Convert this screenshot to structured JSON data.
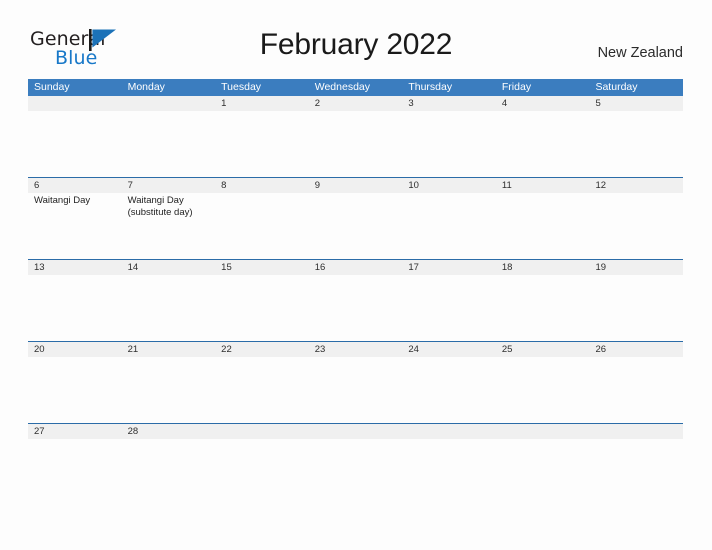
{
  "logo": {
    "word_one": "General",
    "word_two": "Blue",
    "flag_icon": "blue-triangle-flag-icon",
    "dark_color": "#231f20",
    "blue_color": "#1878c8"
  },
  "header": {
    "title": "February 2022",
    "country": "New Zealand"
  },
  "colors": {
    "header_blue": "#3b7dbf",
    "row_divider_blue": "#2b6ca8",
    "date_band_gray": "#f0f0f0",
    "page_background": "#fdfdfd",
    "text_dark": "#1f1f1f"
  },
  "calendar": {
    "month": "February",
    "year": "2022",
    "weekday_headers": [
      "Sunday",
      "Monday",
      "Tuesday",
      "Wednesday",
      "Thursday",
      "Friday",
      "Saturday"
    ],
    "weeks": [
      {
        "days": [
          {
            "date": "",
            "events": []
          },
          {
            "date": "",
            "events": []
          },
          {
            "date": "1",
            "events": []
          },
          {
            "date": "2",
            "events": []
          },
          {
            "date": "3",
            "events": []
          },
          {
            "date": "4",
            "events": []
          },
          {
            "date": "5",
            "events": []
          }
        ]
      },
      {
        "days": [
          {
            "date": "6",
            "events": [
              "Waitangi Day"
            ]
          },
          {
            "date": "7",
            "events": [
              "Waitangi Day",
              "(substitute day)"
            ]
          },
          {
            "date": "8",
            "events": []
          },
          {
            "date": "9",
            "events": []
          },
          {
            "date": "10",
            "events": []
          },
          {
            "date": "11",
            "events": []
          },
          {
            "date": "12",
            "events": []
          }
        ]
      },
      {
        "days": [
          {
            "date": "13",
            "events": []
          },
          {
            "date": "14",
            "events": []
          },
          {
            "date": "15",
            "events": []
          },
          {
            "date": "16",
            "events": []
          },
          {
            "date": "17",
            "events": []
          },
          {
            "date": "18",
            "events": []
          },
          {
            "date": "19",
            "events": []
          }
        ]
      },
      {
        "days": [
          {
            "date": "20",
            "events": []
          },
          {
            "date": "21",
            "events": []
          },
          {
            "date": "22",
            "events": []
          },
          {
            "date": "23",
            "events": []
          },
          {
            "date": "24",
            "events": []
          },
          {
            "date": "25",
            "events": []
          },
          {
            "date": "26",
            "events": []
          }
        ]
      },
      {
        "days": [
          {
            "date": "27",
            "events": []
          },
          {
            "date": "28",
            "events": []
          },
          {
            "date": "",
            "events": []
          },
          {
            "date": "",
            "events": []
          },
          {
            "date": "",
            "events": []
          },
          {
            "date": "",
            "events": []
          },
          {
            "date": "",
            "events": []
          }
        ]
      }
    ]
  }
}
